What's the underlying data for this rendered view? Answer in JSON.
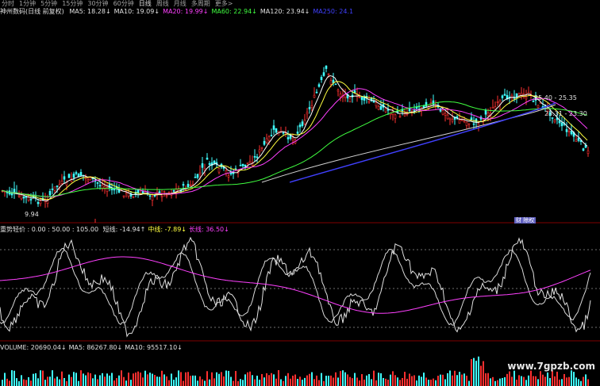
{
  "period_tabs": [
    "分时",
    "1分钟",
    "5分钟",
    "15分钟",
    "30分钟",
    "60分钟",
    "日线",
    "周线",
    "月线",
    "多周期",
    "更多>"
  ],
  "active_tab": "日线",
  "header": {
    "stock": "神州数码(日线 前复权)",
    "ma_items": [
      {
        "label": "MA5: 18.28↓",
        "color": "#e0e0e0"
      },
      {
        "label": "MA10: 19.09↓",
        "color": "#e0e0e0"
      },
      {
        "label": "MA20: 19.99↓",
        "color": "#ff40ff"
      },
      {
        "label": "MA60: 22.94↓",
        "color": "#40ff40"
      },
      {
        "label": "MA120: 23.94↓",
        "color": "#e0e0e0"
      },
      {
        "label": "MA250: 24.1",
        "color": "#4040ff"
      }
    ]
  },
  "price_labels": {
    "low": "9.94",
    "range1": "25.40 - 25.35",
    "range2": "23.31 - 23.30",
    "badge": "财 除权"
  },
  "indicator": {
    "name": "重势轻价 : 0.00 : 50.00 : 105.00",
    "items": [
      {
        "label": "短线: -14.94↑",
        "color": "#e0e0e0"
      },
      {
        "label": "中线: -7.89↓",
        "color": "#ffff40"
      },
      {
        "label": "长线: 36.50↓",
        "color": "#ff40ff"
      }
    ]
  },
  "volume": {
    "items": [
      {
        "label": "VOLUME: 20690.04↓",
        "color": "#e0e0e0"
      },
      {
        "label": "MA5: 86267.80↓",
        "color": "#e0e0e0"
      },
      {
        "label": "MA10: 95517.10↓",
        "color": "#e0e0e0"
      }
    ]
  },
  "watermark": "www.7gpzb.com",
  "colors": {
    "up": "#ff3030",
    "down": "#40ffff",
    "ma5": "#ffffff",
    "ma10": "#ffff40",
    "ma20": "#ff40ff",
    "ma60": "#40ff40",
    "ma120": "#d0d0d0",
    "ma250": "#4040ff"
  }
}
